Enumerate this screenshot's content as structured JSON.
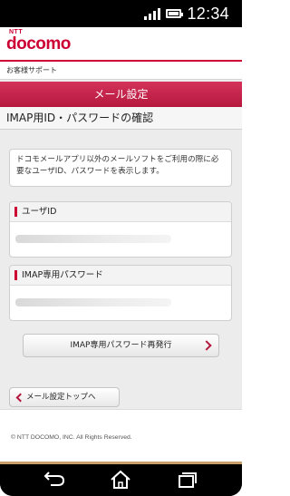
{
  "status_bar": {
    "time": "12:34",
    "signal_icon": "signal-icon",
    "battery_icon": "battery-icon"
  },
  "header": {
    "logo_small": "NTT",
    "logo_brand": "docomo",
    "brand_color": "#cc0033"
  },
  "breadcrumb": {
    "text": "お客様サポート"
  },
  "page": {
    "title": "メール設定",
    "section_title": "IMAP用ID・パスワードの確認",
    "info_text": "ドコモメールアプリ以外のメールソフトをご利用の際に必要なユーザID、パスワードを表示します。"
  },
  "fields": [
    {
      "label": "ユーザID"
    },
    {
      "label": "IMAP専用パスワード"
    }
  ],
  "buttons": {
    "reissue_label": "IMAP専用パスワード再発行",
    "back_label": "メール設定トップへ"
  },
  "footer": {
    "copyright": "© NTT DOCOMO, INC. All Rights Reserved."
  },
  "nav_bar": {
    "items": [
      "back-icon",
      "home-icon",
      "recent-apps-icon"
    ]
  }
}
